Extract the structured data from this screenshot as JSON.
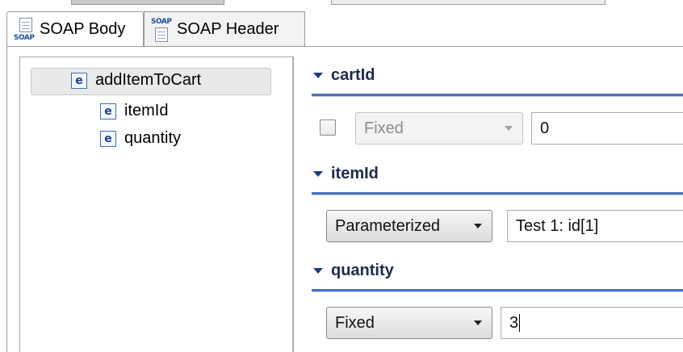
{
  "tabs": [
    {
      "label": "SOAP Body",
      "icon": "soap-body-icon",
      "active": true
    },
    {
      "label": "SOAP Header",
      "icon": "soap-header-icon",
      "active": false
    }
  ],
  "icon_text": "SOAP",
  "tree": {
    "root": {
      "label": "addItemToCart",
      "icon": "element-icon",
      "icon_letter": "e"
    },
    "children": [
      {
        "label": "itemId",
        "icon_letter": "e"
      },
      {
        "label": "quantity",
        "icon_letter": "e"
      }
    ]
  },
  "sections": [
    {
      "title": "cartId",
      "checkbox_checked": false,
      "mode": "Fixed",
      "mode_enabled": false,
      "value": "0"
    },
    {
      "title": "itemId",
      "mode": "Parameterized",
      "mode_enabled": true,
      "value": "Test 1: id[1]"
    },
    {
      "title": "quantity",
      "mode": "Fixed",
      "mode_enabled": true,
      "value": "3"
    }
  ],
  "colors": {
    "accent": "#4a72b8",
    "section_title": "#1f2b4a"
  }
}
